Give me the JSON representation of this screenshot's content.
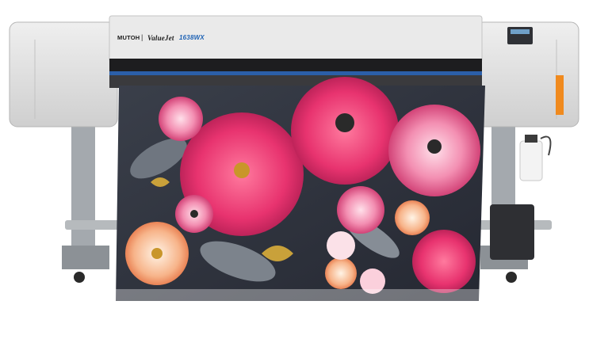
{
  "printer": {
    "brand": "MUTOH",
    "separator": "|",
    "model": "ValueJet",
    "model_code": "1638WX"
  },
  "colors": {
    "body": "#dcdcdc",
    "body_shadow": "#bdbdbd",
    "carriage_rail": "#2b5fa8",
    "legs": "#9aa0a6",
    "petal_pink": "#e8336f",
    "petal_magenta": "#c21d5a",
    "leaf_gray": "#6f7680",
    "background": "#ffffff"
  },
  "icons": [
    "control-panel-icon",
    "ink-bottle-icon",
    "caster-wheel-icon"
  ]
}
